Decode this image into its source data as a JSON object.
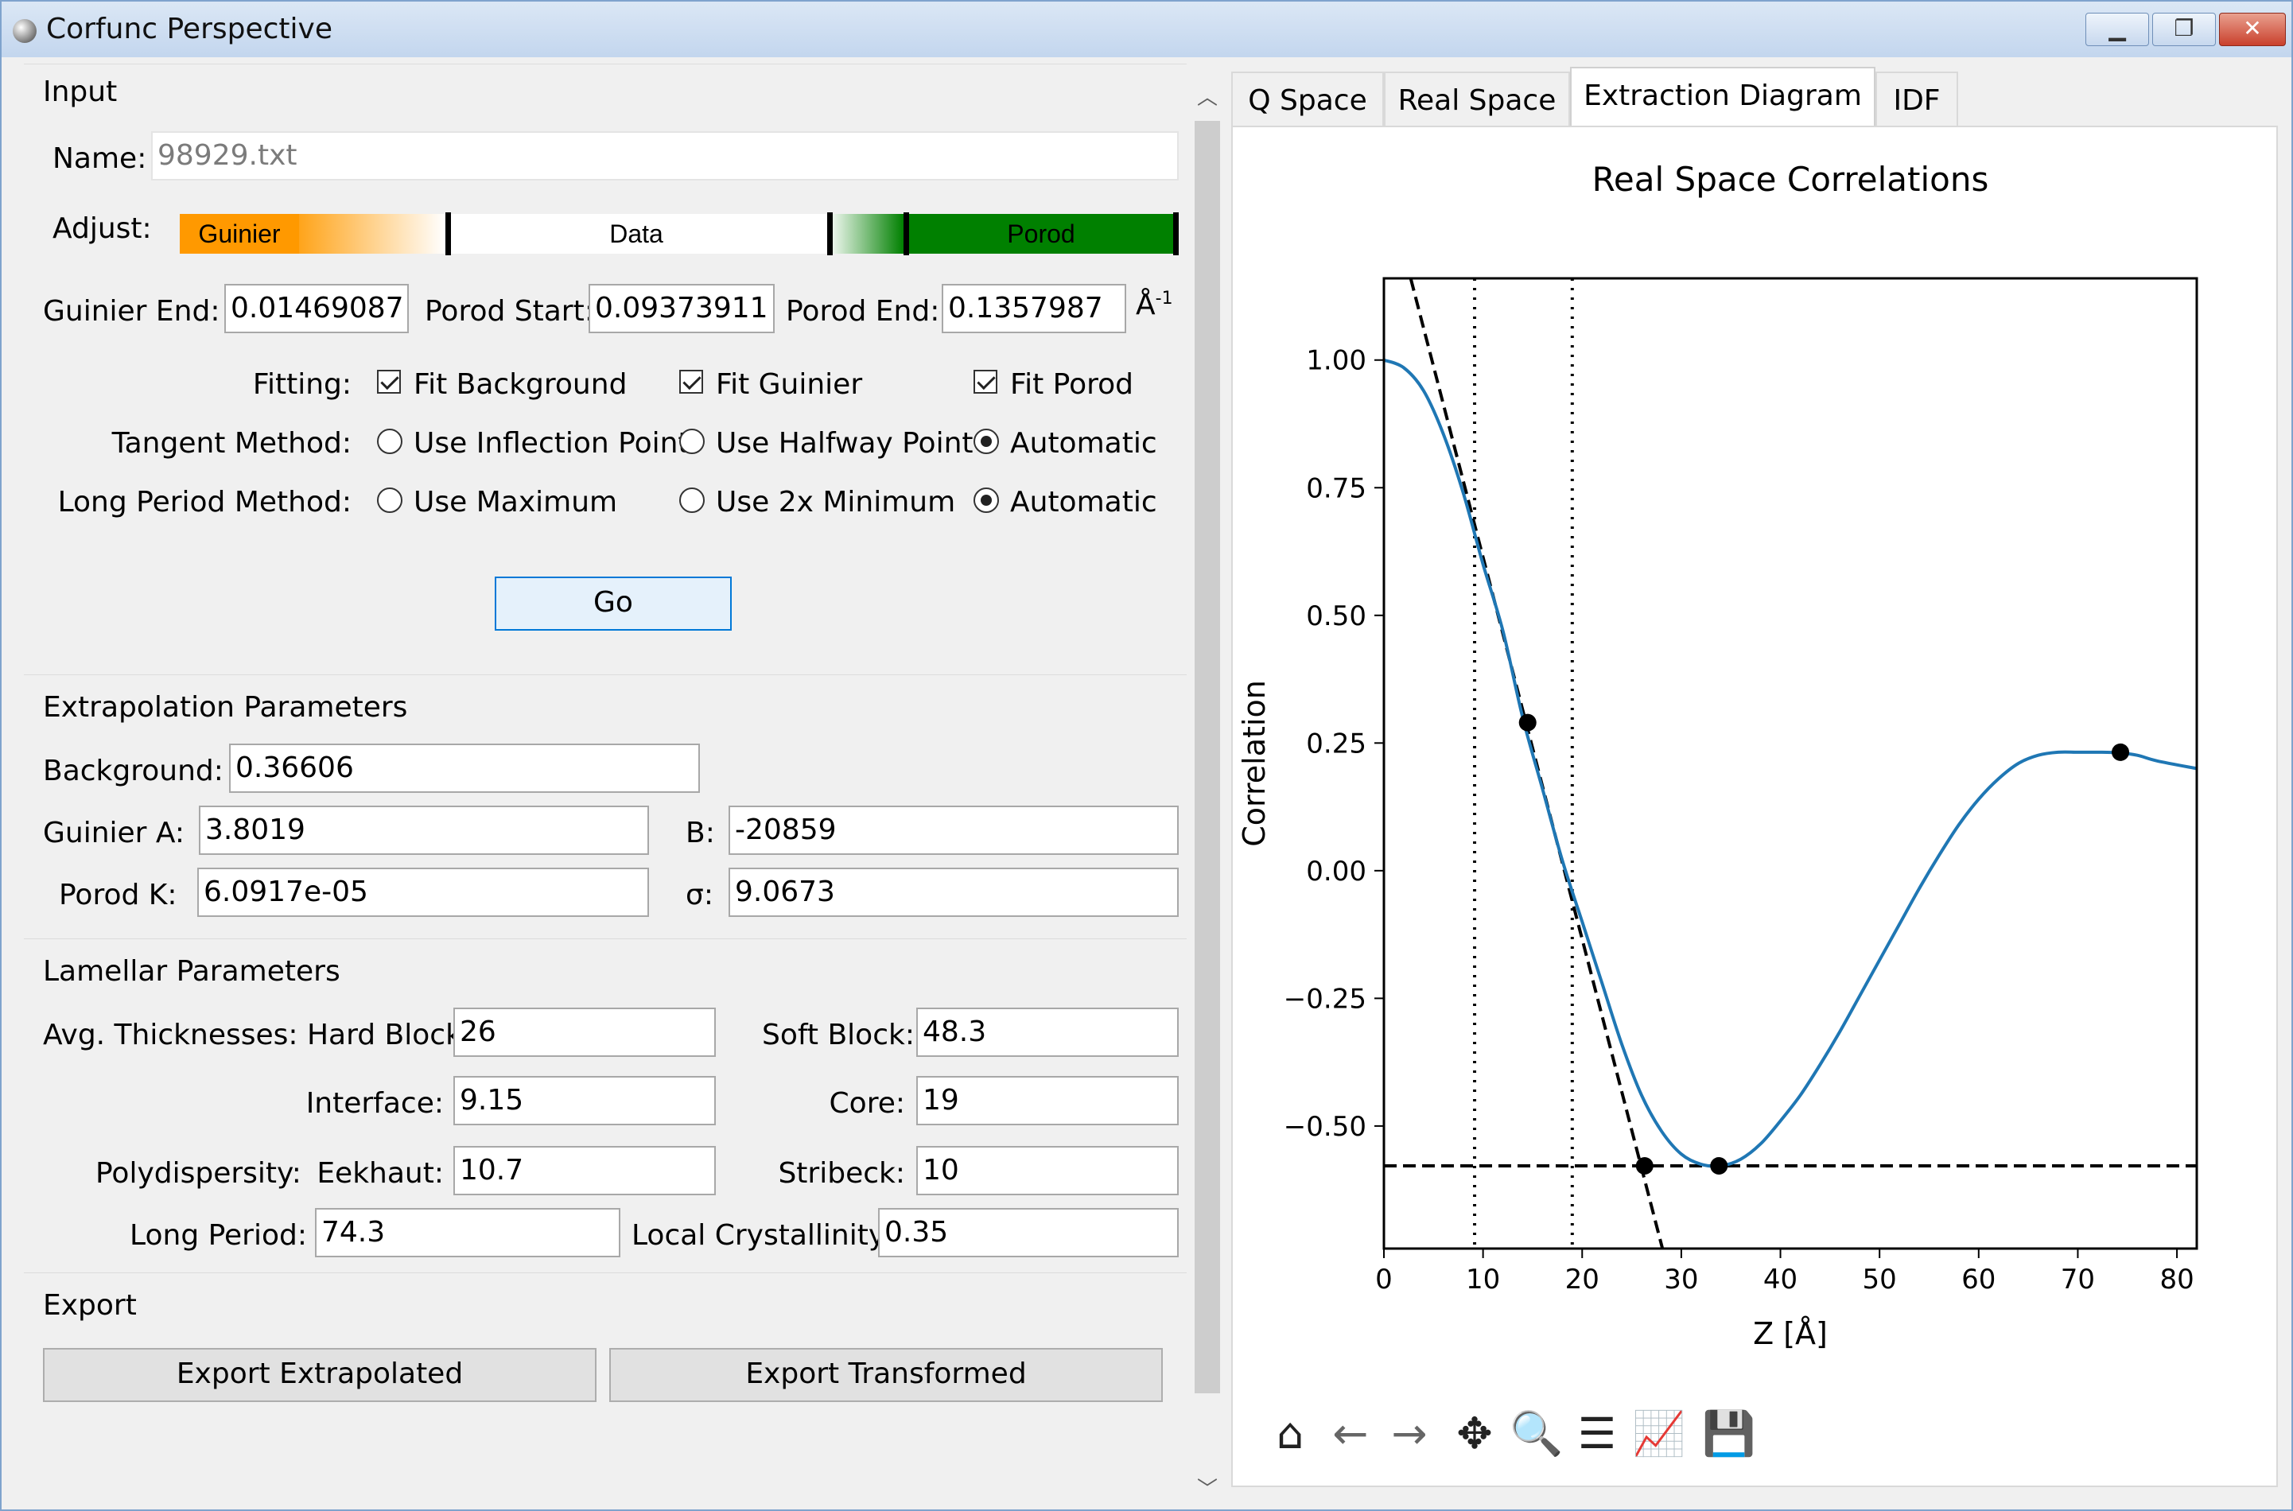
{
  "window": {
    "title": "Corfunc Perspective",
    "min": "▁",
    "max": "❐",
    "close": "✕"
  },
  "input": {
    "title": "Input",
    "name_label": "Name:",
    "name_value": "98929.txt",
    "adjust_label": "Adjust:",
    "adjust_guinier": "Guinier",
    "adjust_data": "Data",
    "adjust_porod": "Porod",
    "guinier_end_label": "Guinier End:",
    "guinier_end": "0.01469087",
    "porod_start_label": "Porod Start:",
    "porod_start": "0.09373911",
    "porod_end_label": "Porod End:",
    "porod_end": "0.1357987",
    "unit": "Å",
    "unit_exp": "-1",
    "fitting_label": "Fitting:",
    "fit_background": "Fit Background",
    "fit_guinier": "Fit Guinier",
    "fit_porod": "Fit Porod",
    "tangent_label": "Tangent Method:",
    "tan_inflection": "Use Inflection Point",
    "tan_halfway": "Use Halfway Point",
    "tan_auto": "Automatic",
    "long_period_label": "Long Period Method:",
    "lp_max": "Use Maximum",
    "lp_min": "Use 2x Minimum",
    "lp_auto": "Automatic",
    "go": "Go"
  },
  "extrap": {
    "title": "Extrapolation Parameters",
    "background_label": "Background:",
    "background": "0.36606",
    "guinier_a_label": "Guinier  A:",
    "guinier_a": "3.8019",
    "b_label": "B:",
    "b": "-20859",
    "porod_k_label": "Porod  K:",
    "porod_k": "6.0917e-05",
    "sigma_label": "σ:",
    "sigma": "9.0673"
  },
  "lamellar": {
    "title": "Lamellar Parameters",
    "avg_label": "Avg. Thicknesses: Hard Block:",
    "hard_block": "26",
    "soft_label": "Soft Block:",
    "soft_block": "48.3",
    "interface_label": "Interface:",
    "interface": "9.15",
    "core_label": "Core:",
    "core": "19",
    "poly_label": "Polydispersity:",
    "eekhaut_label": "Eekhaut:",
    "eekhaut": "10.7",
    "stribeck_label": "Stribeck:",
    "stribeck": "10",
    "long_period_label": "Long Period:",
    "long_period": "74.3",
    "local_cryst_label": "Local Crystallinity:",
    "local_cryst": "0.35"
  },
  "export": {
    "title": "Export",
    "extrapolated": "Export Extrapolated",
    "transformed": "Export Transformed"
  },
  "tabs": [
    "Q Space",
    "Real Space",
    "Extraction Diagram",
    "IDF"
  ],
  "colors": {
    "curve": "#1f77b4",
    "guinier": "#ff9900",
    "porod": "#008000"
  },
  "chart_data": {
    "type": "line",
    "title": "Real Space Correlations",
    "xlabel": "Z [Å]",
    "ylabel": "Correlation",
    "xlim": [
      0,
      82
    ],
    "ylim": [
      -0.74,
      1.16
    ],
    "xticks": [
      0,
      10,
      20,
      30,
      40,
      50,
      60,
      70,
      80
    ],
    "yticks": [
      1.0,
      0.75,
      0.5,
      0.25,
      0.0,
      -0.25,
      -0.5
    ],
    "ytick_labels": [
      "1.00",
      "0.75",
      "0.50",
      "0.25",
      "0.00",
      "−0.25",
      "−0.50"
    ],
    "series": [
      {
        "values_x": [
          0,
          2,
          4,
          6,
          8,
          10,
          12,
          14,
          16,
          18,
          20,
          22,
          24,
          26,
          28,
          30,
          32,
          34,
          36,
          38,
          40,
          42,
          44,
          46,
          48,
          50,
          52,
          54,
          56,
          58,
          60,
          62,
          64,
          66,
          68,
          70,
          72,
          74,
          76,
          78,
          82
        ],
        "values_y": [
          1.0,
          0.985,
          0.94,
          0.855,
          0.74,
          0.6,
          0.47,
          0.3,
          0.16,
          0.02,
          -0.1,
          -0.22,
          -0.34,
          -0.44,
          -0.51,
          -0.555,
          -0.575,
          -0.578,
          -0.565,
          -0.535,
          -0.49,
          -0.44,
          -0.38,
          -0.315,
          -0.245,
          -0.175,
          -0.105,
          -0.035,
          0.03,
          0.09,
          0.14,
          0.18,
          0.21,
          0.226,
          0.232,
          0.232,
          0.232,
          0.231,
          0.226,
          0.215,
          0.2
        ]
      }
    ],
    "tangent_line": {
      "x1": 2.7,
      "y1": 1.16,
      "x2": 28.1,
      "y2": -0.74
    },
    "baseline_y": -0.578,
    "vlines_x": [
      9.15,
      19
    ],
    "points": [
      {
        "x": 14.5,
        "y": 0.29
      },
      {
        "x": 26.3,
        "y": -0.578
      },
      {
        "x": 33.8,
        "y": -0.578
      },
      {
        "x": 74.3,
        "y": 0.232
      }
    ]
  }
}
